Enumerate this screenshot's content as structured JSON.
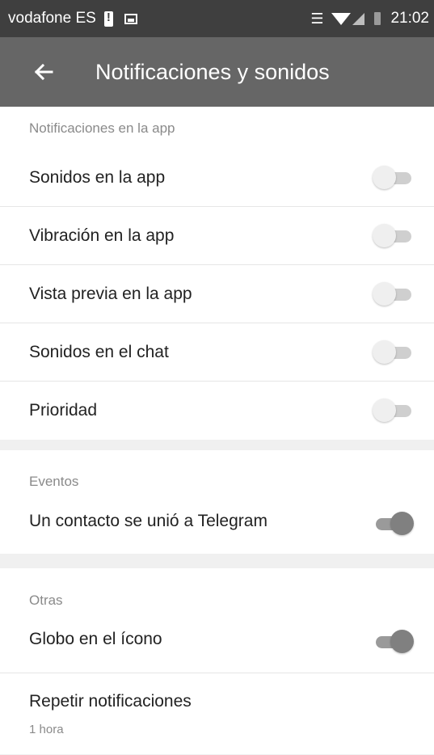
{
  "status_bar": {
    "carrier": "vodafone ES",
    "time": "21:02",
    "icons": [
      "battery-alert-icon",
      "image-icon",
      "vibrate-icon",
      "wifi-icon",
      "signal-icon",
      "battery-icon"
    ]
  },
  "app_bar": {
    "back_icon": "arrow-left-icon",
    "title": "Notificaciones y sonidos"
  },
  "sections": {
    "in_app": {
      "header": "Notificaciones en la app",
      "items": [
        {
          "label": "Sonidos en la app",
          "enabled": false
        },
        {
          "label": "Vibración en la app",
          "enabled": false
        },
        {
          "label": "Vista previa en la app",
          "enabled": false
        },
        {
          "label": "Sonidos en el chat",
          "enabled": false
        },
        {
          "label": "Prioridad",
          "enabled": false
        }
      ]
    },
    "events": {
      "header": "Eventos",
      "items": [
        {
          "label": "Un contacto se unió a Telegram",
          "enabled": true
        }
      ]
    },
    "other": {
      "header": "Otras",
      "items": [
        {
          "label": "Globo en el ícono",
          "enabled": true
        }
      ],
      "repeat": {
        "label": "Repetir notificaciones",
        "value": "1 hora"
      }
    }
  },
  "colors": {
    "status_bar": "#3f3f3f",
    "app_bar": "#666666",
    "background": "#f0f0f0",
    "toggle_on": "#808080",
    "toggle_off": "#efefef"
  }
}
